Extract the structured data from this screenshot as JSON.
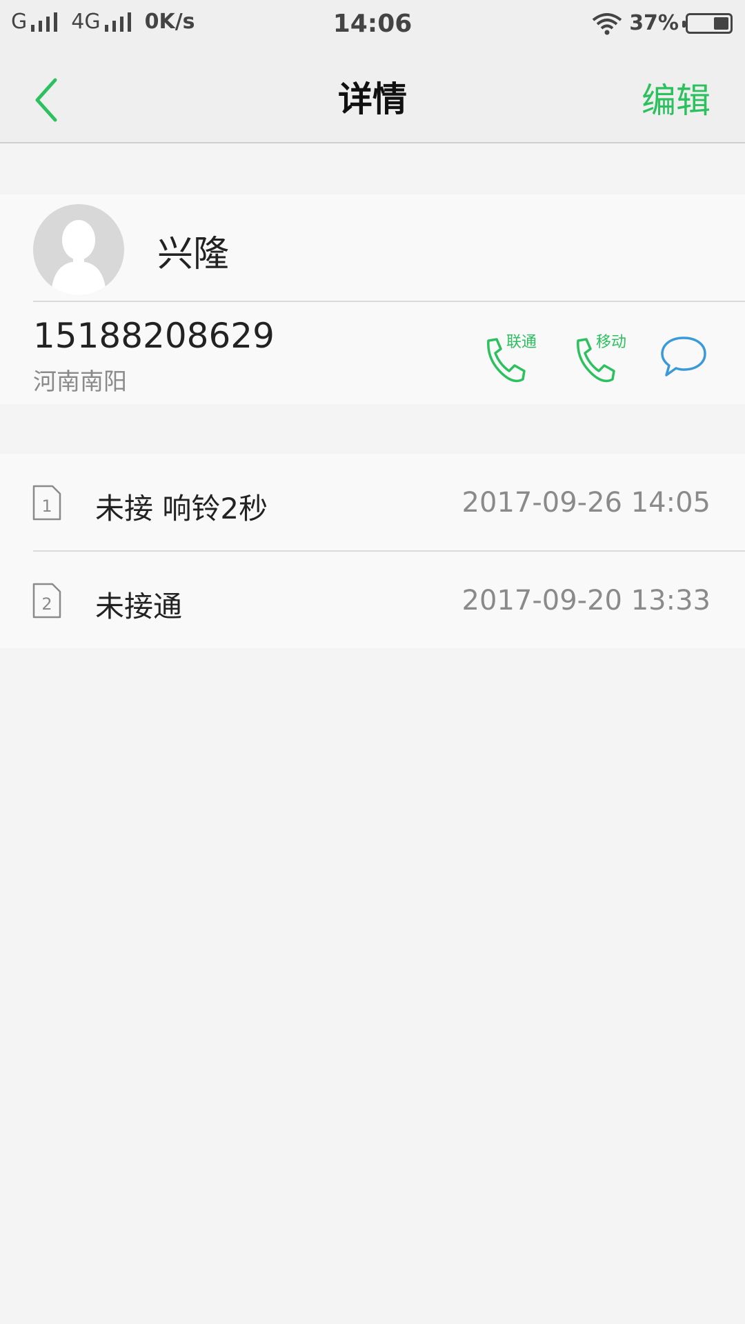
{
  "status_bar": {
    "sim1_label": "G",
    "sim2_label": "4G",
    "speed": "0K/s",
    "time": "14:06",
    "battery": "37%",
    "battery_level": 0.37
  },
  "header": {
    "title": "详情",
    "edit_label": "编辑"
  },
  "contact": {
    "name": "兴隆",
    "phone": "15188208629",
    "location": "河南南阳",
    "call_options": [
      {
        "carrier": "联通"
      },
      {
        "carrier": "移动"
      }
    ]
  },
  "call_log": [
    {
      "sim": "1",
      "status": "未接 响铃2秒",
      "datetime": "2017-09-26 14:05"
    },
    {
      "sim": "2",
      "status": "未接通",
      "datetime": "2017-09-20 13:33"
    }
  ],
  "colors": {
    "accent_green": "#2cc05e",
    "message_blue": "#3a9ad9"
  }
}
